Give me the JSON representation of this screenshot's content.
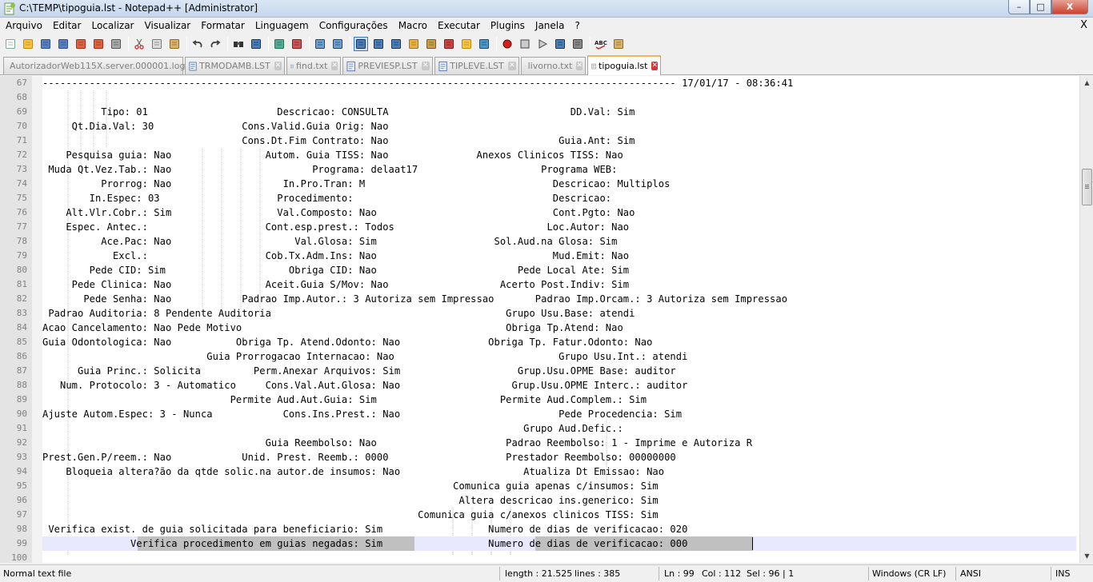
{
  "window": {
    "title": "C:\\TEMP\\tipoguia.lst - Notepad++ [Administrator]",
    "minimize_label": "–",
    "maximize_label": "□",
    "close_label": "X"
  },
  "menu": {
    "items": [
      "Arquivo",
      "Editar",
      "Localizar",
      "Visualizar",
      "Formatar",
      "Linguagem",
      "Configurações",
      "Macro",
      "Executar",
      "Plugins",
      "Janela",
      "?"
    ],
    "close_label": "X"
  },
  "toolbar": {
    "buttons": [
      "new-file",
      "open-file",
      "save",
      "save-all",
      "close",
      "close-all",
      "print",
      "cut",
      "copy",
      "paste",
      "undo",
      "redo",
      "find",
      "replace",
      "zoom-in",
      "zoom-out",
      "sync-vertical",
      "sync-horizontal",
      "word-wrap",
      "show-all-chars",
      "indent-guide",
      "user-language",
      "document-map",
      "function-list",
      "folder-as-workspace",
      "monitoring",
      "record-macro",
      "stop-record",
      "play-macro",
      "run-macro-multiple",
      "save-macro",
      "spell-check",
      "spell-check-settings"
    ]
  },
  "tabs": [
    {
      "label": "AutorizadorWeb115X.server.000001.log",
      "active": false
    },
    {
      "label": "TRMODAMB.LST",
      "active": false
    },
    {
      "label": "find.txt",
      "active": false
    },
    {
      "label": "PREVIESP.LST",
      "active": false
    },
    {
      "label": "TIPLEVE.LST",
      "active": false
    },
    {
      "label": "livorno.txt",
      "active": false
    },
    {
      "label": "tipoguia.lst",
      "active": true
    }
  ],
  "editor": {
    "lines": [
      {
        "n": "67",
        "text": "------------------------------------------------------------------------------------------------------------ 17/01/17 - 08:36:41"
      },
      {
        "n": "68",
        "text": ""
      },
      {
        "n": "69",
        "text": "          Tipo: 01                      Descricao: CONSULTA                               DD.Val: Sim"
      },
      {
        "n": "70",
        "text": "     Qt.Dia.Val: 30               Cons.Valid.Guia Orig: Nao"
      },
      {
        "n": "71",
        "text": "                                  Cons.Dt.Fim Contrato: Nao                             Guia.Ant: Sim"
      },
      {
        "n": "72",
        "text": "    Pesquisa guia: Nao                Autom. Guia TISS: Nao               Anexos Clinicos TISS: Nao"
      },
      {
        "n": "73",
        "text": " Muda Qt.Vez.Tab.: Nao                        Programa: delaat17                     Programa WEB:"
      },
      {
        "n": "74",
        "text": "          Prorrog: Nao                   In.Pro.Tran: M                                Descricao: Multiplos"
      },
      {
        "n": "75",
        "text": "        In.Espec: 03                    Procedimento:                                  Descricao:"
      },
      {
        "n": "76",
        "text": "    Alt.Vlr.Cobr.: Sim                  Val.Composto: Nao                              Cont.Pgto: Nao"
      },
      {
        "n": "77",
        "text": "    Espec. Antec.:                    Cont.esp.prest.: Todos                          Loc.Autor: Nao"
      },
      {
        "n": "78",
        "text": "          Ace.Pac: Nao                     Val.Glosa: Sim                    Sol.Aud.na Glosa: Sim"
      },
      {
        "n": "79",
        "text": "            Excl.:                    Cob.Tx.Adm.Ins: Nao                              Mud.Emit: Nao"
      },
      {
        "n": "80",
        "text": "        Pede CID: Sim                     Obriga CID: Nao                        Pede Local Ate: Sim"
      },
      {
        "n": "81",
        "text": "     Pede Clinica: Nao                Aceit.Guia S/Mov: Nao                   Acerto Post.Indiv: Sim"
      },
      {
        "n": "82",
        "text": "       Pede Senha: Nao            Padrao Imp.Autor.: 3 Autoriza sem Impressao       Padrao Imp.Orcam.: 3 Autoriza sem Impressao"
      },
      {
        "n": "83",
        "text": " Padrao Auditoria: 8 Pendente Auditoria                                        Grupo Usu.Base: atendi"
      },
      {
        "n": "84",
        "text": "Acao Cancelamento: Nao Pede Motivo                                             Obriga Tp.Atend: Nao"
      },
      {
        "n": "85",
        "text": "Guia Odontologica: Nao           Obriga Tp. Atend.Odonto: Nao               Obriga Tp. Fatur.Odonto: Nao"
      },
      {
        "n": "86",
        "text": "                            Guia Prorrogacao Internacao: Nao                            Grupo Usu.Int.: atendi"
      },
      {
        "n": "87",
        "text": "      Guia Princ.: Solicita         Perm.Anexar Arquivos: Sim                    Grup.Usu.OPME Base: auditor"
      },
      {
        "n": "88",
        "text": "   Num. Protocolo: 3 - Automatico     Cons.Val.Aut.Glosa: Nao                   Grup.Usu.OPME Interc.: auditor"
      },
      {
        "n": "89",
        "text": "                                Permite Aud.Aut.Guia: Sim                     Permite Aud.Complem.: Sim"
      },
      {
        "n": "90",
        "text": "Ajuste Autom.Espec: 3 - Nunca            Cons.Ins.Prest.: Nao                           Pede Procedencia: Sim"
      },
      {
        "n": "91",
        "text": "                                                                                  Grupo Aud.Defic.:"
      },
      {
        "n": "92",
        "text": "                                      Guia Reembolso: Nao                      Padrao Reembolso: 1 - Imprime e Autoriza R"
      },
      {
        "n": "93",
        "text": "Prest.Gen.P/reem.: Nao            Unid. Prest. Reemb.: 0000                    Prestador Reembolso: 00000000"
      },
      {
        "n": "94",
        "text": "    Bloqueia altera?ão da qtde solic.na autor.de insumos: Nao                     Atualiza Dt Emissao: Nao"
      },
      {
        "n": "95",
        "text": "                                                                      Comunica guia apenas c/insumos: Sim"
      },
      {
        "n": "96",
        "text": "                                                                       Altera descricao ins.generico: Sim"
      },
      {
        "n": "97",
        "text": "                                                                Comunica guia c/anexos clinicos TISS: Sim"
      },
      {
        "n": "98",
        "text": " Verifica exist. de guia solicitada para beneficiario: Sim                  Numero de dias de verificacao: 020"
      },
      {
        "n": "99",
        "text": "               Verifica procedimento em guias negadas: Sim                  Numero de dias de verificacao: 000"
      },
      {
        "n": "100",
        "text": ""
      }
    ]
  },
  "status": {
    "file_type": "Normal text file",
    "length": "length : 21.525",
    "lines": "lines : 385",
    "ln": "Ln : 99",
    "col": "Col : 112",
    "sel": "Sel : 96 | 1",
    "eol": "Windows (CR LF)",
    "encoding": "ANSI",
    "mode": "INS"
  }
}
